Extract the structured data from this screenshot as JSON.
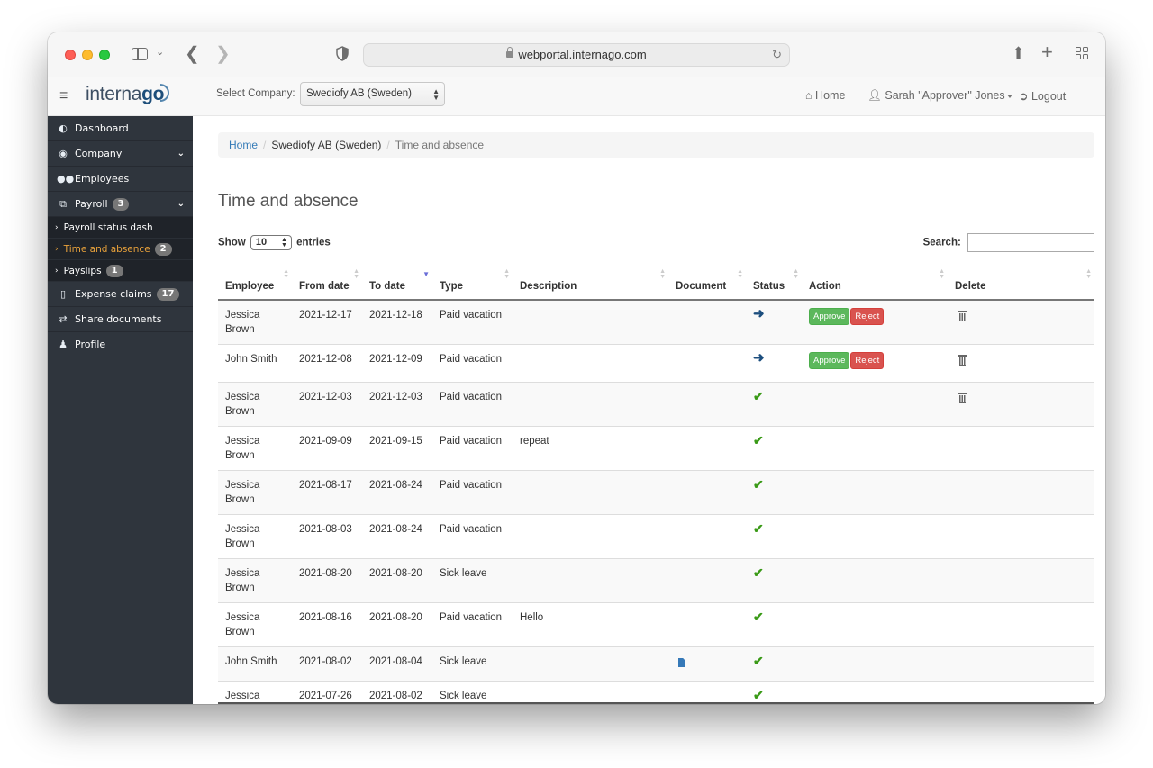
{
  "browser": {
    "url": "webportal.internago.com",
    "icons": [
      "sidebar-toggle-icon",
      "chevron-down-icon",
      "back-icon",
      "forward-icon",
      "shield-icon",
      "lock-icon",
      "reload-icon",
      "share-icon",
      "new-tab-icon",
      "tab-overview-icon"
    ]
  },
  "header": {
    "menu_icon": "≡",
    "logo_text": "interna",
    "logo_go": "go",
    "select_company_label": "Select Company:",
    "selected_company": "Swediofy AB (Sweden)",
    "nav": {
      "home": "Home",
      "user": "Sarah \"Approver\" Jones",
      "logout": "Logout"
    }
  },
  "sidebar": {
    "items": [
      {
        "label": "Dashboard",
        "icon": "dashboard-icon"
      },
      {
        "label": "Company",
        "icon": "globe-icon",
        "expandable": true
      },
      {
        "label": "Employees",
        "icon": "users-icon"
      },
      {
        "label": "Payroll",
        "icon": "payroll-icon",
        "badge": "3",
        "expandable": true
      },
      {
        "label": "Expense claims",
        "icon": "receipt-icon",
        "badge": "17"
      },
      {
        "label": "Share documents",
        "icon": "exchange-icon"
      },
      {
        "label": "Profile",
        "icon": "user-icon"
      }
    ],
    "payroll_sub": [
      {
        "label": "Payroll status dash"
      },
      {
        "label": "Time and absence",
        "badge": "2",
        "active": true
      },
      {
        "label": "Payslips",
        "badge": "1"
      }
    ],
    "active_color": "#e9a23b"
  },
  "breadcrumb": {
    "home": "Home",
    "company": "Swediofy AB (Sweden)",
    "current": "Time and absence"
  },
  "page": {
    "title": "Time and absence",
    "show_label": "Show",
    "entries_value": "10",
    "entries_label": "entries",
    "search_label": "Search:",
    "search_value": ""
  },
  "table": {
    "columns": [
      "Employee",
      "From date",
      "To date",
      "Type",
      "Description",
      "Document",
      "Status",
      "Action",
      "Delete"
    ],
    "sorted_column": "To date",
    "sort_direction": "desc",
    "action_labels": {
      "approve": "Approve",
      "reject": "Reject"
    },
    "rows": [
      {
        "employee": "Jessica Brown",
        "from": "2021-12-17",
        "to": "2021-12-18",
        "type": "Paid vacation",
        "description": "",
        "document": false,
        "status": "pending",
        "actions": true,
        "deletable": true
      },
      {
        "employee": "John Smith",
        "from": "2021-12-08",
        "to": "2021-12-09",
        "type": "Paid vacation",
        "description": "",
        "document": false,
        "status": "pending",
        "actions": true,
        "deletable": true
      },
      {
        "employee": "Jessica Brown",
        "from": "2021-12-03",
        "to": "2021-12-03",
        "type": "Paid vacation",
        "description": "",
        "document": false,
        "status": "approved",
        "actions": false,
        "deletable": true
      },
      {
        "employee": "Jessica Brown",
        "from": "2021-09-09",
        "to": "2021-09-15",
        "type": "Paid vacation",
        "description": "repeat",
        "document": false,
        "status": "approved",
        "actions": false,
        "deletable": false
      },
      {
        "employee": "Jessica Brown",
        "from": "2021-08-17",
        "to": "2021-08-24",
        "type": "Paid vacation",
        "description": "",
        "document": false,
        "status": "approved",
        "actions": false,
        "deletable": false
      },
      {
        "employee": "Jessica Brown",
        "from": "2021-08-03",
        "to": "2021-08-24",
        "type": "Paid vacation",
        "description": "",
        "document": false,
        "status": "approved",
        "actions": false,
        "deletable": false
      },
      {
        "employee": "Jessica Brown",
        "from": "2021-08-20",
        "to": "2021-08-20",
        "type": "Sick leave",
        "description": "",
        "document": false,
        "status": "approved",
        "actions": false,
        "deletable": false
      },
      {
        "employee": "Jessica Brown",
        "from": "2021-08-16",
        "to": "2021-08-20",
        "type": "Paid vacation",
        "description": "Hello",
        "document": false,
        "status": "approved",
        "actions": false,
        "deletable": false
      },
      {
        "employee": "John Smith",
        "from": "2021-08-02",
        "to": "2021-08-04",
        "type": "Sick leave",
        "description": "",
        "document": true,
        "status": "approved",
        "actions": false,
        "deletable": false
      },
      {
        "employee": "Jessica Brown",
        "from": "2021-07-26",
        "to": "2021-08-02",
        "type": "Sick leave",
        "description": "",
        "document": false,
        "status": "approved",
        "actions": false,
        "deletable": false
      }
    ]
  },
  "colors": {
    "sidebar_bg": "#2f353d",
    "approve": "#5cb85c",
    "reject": "#d9534f",
    "status_pending": "#1c4e7e",
    "status_approved": "#3a9a17",
    "link": "#337ab7"
  }
}
